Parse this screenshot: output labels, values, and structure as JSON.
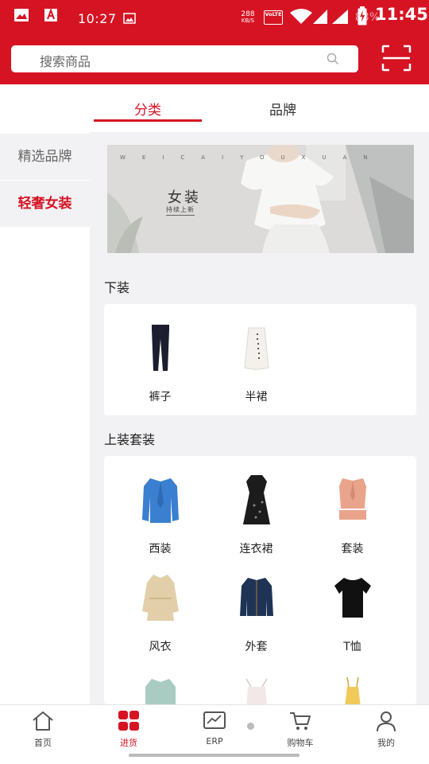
{
  "status_bar": {
    "time_left": "10:27",
    "net_speed_value": "288",
    "net_speed_unit": "KB/S",
    "volte": "VoLTE",
    "battery_pct": "83%",
    "time_right": "11:45"
  },
  "search": {
    "placeholder": "搜索商品"
  },
  "tabs": [
    {
      "label": "分类",
      "active": true
    },
    {
      "label": "品牌",
      "active": false
    }
  ],
  "sidebar": {
    "items": [
      {
        "label": "精选品牌",
        "active": false
      },
      {
        "label": "轻奢女装",
        "active": true
      }
    ]
  },
  "banner": {
    "spell": "WEICAIYOUXUAN",
    "title": "女装",
    "subtitle": "持续上新"
  },
  "sections": [
    {
      "title": "下装",
      "items": [
        {
          "label": "裤子",
          "icon": "pants-product-image"
        },
        {
          "label": "半裙",
          "icon": "skirt-product-image"
        }
      ]
    },
    {
      "title": "上装套装",
      "items": [
        {
          "label": "西装",
          "icon": "blazer-product-image"
        },
        {
          "label": "连衣裙",
          "icon": "dress-product-image"
        },
        {
          "label": "套装",
          "icon": "suit-set-product-image"
        },
        {
          "label": "风衣",
          "icon": "trench-coat-product-image"
        },
        {
          "label": "外套",
          "icon": "jacket-product-image"
        },
        {
          "label": "T恤",
          "icon": "tshirt-product-image"
        }
      ]
    }
  ],
  "bottom_nav": [
    {
      "label": "首页",
      "icon": "home-icon",
      "active": false
    },
    {
      "label": "进货",
      "icon": "grid-icon",
      "active": true
    },
    {
      "label": "ERP",
      "icon": "erp-chart-icon",
      "active": false
    },
    {
      "label": "购物车",
      "icon": "cart-icon",
      "active": false
    },
    {
      "label": "我的",
      "icon": "profile-icon",
      "active": false
    }
  ],
  "colors": {
    "brand_red": "#d61323",
    "background": "#f2f2f4",
    "card": "#ffffff"
  }
}
